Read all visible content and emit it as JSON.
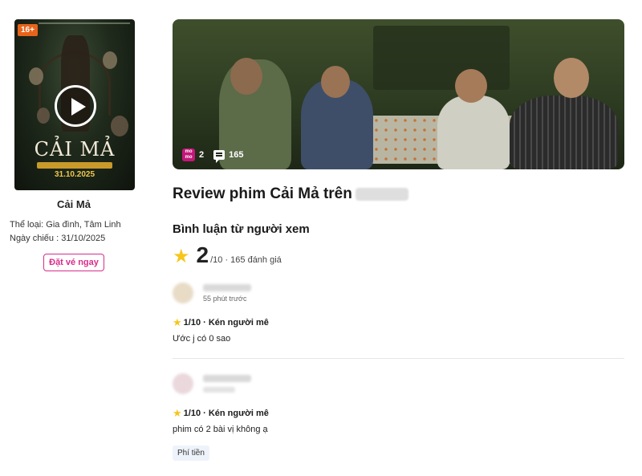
{
  "movie": {
    "age_rating": "16+",
    "poster_title": "CẢI MẢ",
    "poster_date": "31.10.2025",
    "name": "Cải Mả",
    "genre_label": "Thể loại:",
    "genre_value": "Gia đình, Tâm Linh",
    "release_label": "Ngày chiếu :",
    "release_value": "31/10/2025",
    "book_button": "Đặt vé ngay"
  },
  "banner": {
    "momo_label": "mo mo",
    "momo_count": "2",
    "comment_count": "165"
  },
  "review_title": "Review phim Cải Mả trên",
  "audience": {
    "section_title": "Bình luận từ người xem",
    "score": "2",
    "score_detail": "/10 · 165 đánh giá"
  },
  "reviews": [
    {
      "time": "55 phút trước",
      "rating_text": "1/10 · Kén người mê",
      "text": "Ước j có 0 sao"
    },
    {
      "rating_text": "1/10 · Kén người mê",
      "text": "phim có 2 bài vị không ạ",
      "tag": "Phí tiền"
    }
  ],
  "colors": {
    "accent": "#d82d8b",
    "star": "#f6c61d",
    "age_badge": "#e8641a"
  }
}
